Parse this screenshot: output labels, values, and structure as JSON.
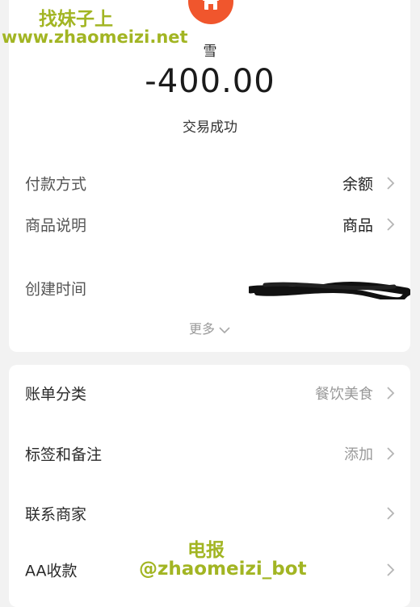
{
  "watermark": {
    "line1": "找妹子上",
    "line2": "www.zhaomeizi.net",
    "line3": "电报",
    "line4": "@zhaomeizi_bot"
  },
  "header": {
    "merchant_name": "雪",
    "amount": "-400.00",
    "status": "交易成功",
    "avatar_color": "#f0562d"
  },
  "details": {
    "payment_method": {
      "label": "付款方式",
      "value": "余额"
    },
    "product_desc": {
      "label": "商品说明",
      "value": "商品"
    },
    "created_time": {
      "label": "创建时间"
    },
    "more_label": "更多"
  },
  "actions": {
    "category": {
      "label": "账单分类",
      "value": "餐饮美食"
    },
    "tags": {
      "label": "标签和备注",
      "value": "添加"
    },
    "contact": {
      "label": "联系商家"
    },
    "aa": {
      "label": "AA收款"
    }
  },
  "colors": {
    "watermark": "#a2b523",
    "background": "#f2f2f2"
  }
}
